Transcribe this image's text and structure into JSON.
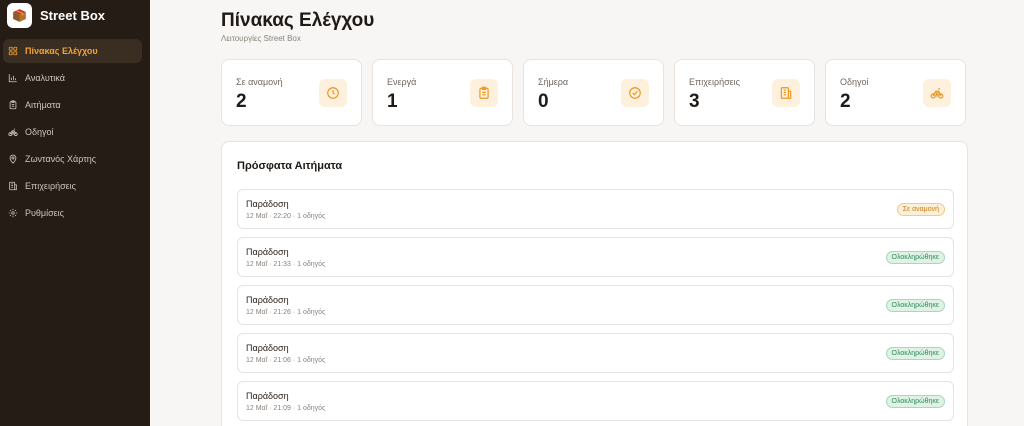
{
  "brand": {
    "name": "Street Box",
    "logo_icon": "box-logo-icon"
  },
  "sidebar": {
    "items": [
      {
        "label": "Πίνακας Ελέγχου",
        "icon": "dashboard-grid-icon",
        "active": true
      },
      {
        "label": "Αναλυτικά",
        "icon": "bar-chart-icon",
        "active": false
      },
      {
        "label": "Αιτήματα",
        "icon": "clipboard-icon",
        "active": false
      },
      {
        "label": "Οδηγοί",
        "icon": "bike-icon",
        "active": false
      },
      {
        "label": "Ζωντανός Χάρτης",
        "icon": "map-pin-icon",
        "active": false
      },
      {
        "label": "Επιχειρήσεις",
        "icon": "building-icon",
        "active": false
      },
      {
        "label": "Ρυθμίσεις",
        "icon": "gear-icon",
        "active": false
      }
    ]
  },
  "header": {
    "title": "Πίνακας Ελέγχου",
    "subtitle": "Λειτουργίες Street Box"
  },
  "stats": [
    {
      "label": "Σε αναμονή",
      "value": "2",
      "icon": "clock-icon"
    },
    {
      "label": "Ενεργά",
      "value": "1",
      "icon": "clipboard-icon"
    },
    {
      "label": "Σήμερα",
      "value": "0",
      "icon": "check-circle-icon"
    },
    {
      "label": "Επιχειρήσεις",
      "value": "3",
      "icon": "building-icon"
    },
    {
      "label": "Οδηγοί",
      "value": "2",
      "icon": "bike-icon"
    }
  ],
  "recent": {
    "title": "Πρόσφατα Αιτήματα",
    "orders": [
      {
        "title": "Παράδοση",
        "meta": "12 Μαΐ · 22:20 · 1 οδηγός",
        "status": "Σε αναμονή",
        "status_kind": "pending"
      },
      {
        "title": "Παράδοση",
        "meta": "12 Μαΐ · 21:33 · 1 οδηγός",
        "status": "Ολοκληρώθηκε",
        "status_kind": "done"
      },
      {
        "title": "Παράδοση",
        "meta": "12 Μαΐ · 21:26 · 1 οδηγός",
        "status": "Ολοκληρώθηκε",
        "status_kind": "done"
      },
      {
        "title": "Παράδοση",
        "meta": "12 Μαΐ · 21:06 · 1 οδηγός",
        "status": "Ολοκληρώθηκε",
        "status_kind": "done"
      },
      {
        "title": "Παράδοση",
        "meta": "12 Μαΐ · 21:09 · 1 οδηγός",
        "status": "Ολοκληρώθηκε",
        "status_kind": "done"
      }
    ]
  },
  "colors": {
    "sidebar_bg": "#251c16",
    "accent": "#f2a33a",
    "pending": "#c97b13",
    "done": "#2f8a55"
  }
}
